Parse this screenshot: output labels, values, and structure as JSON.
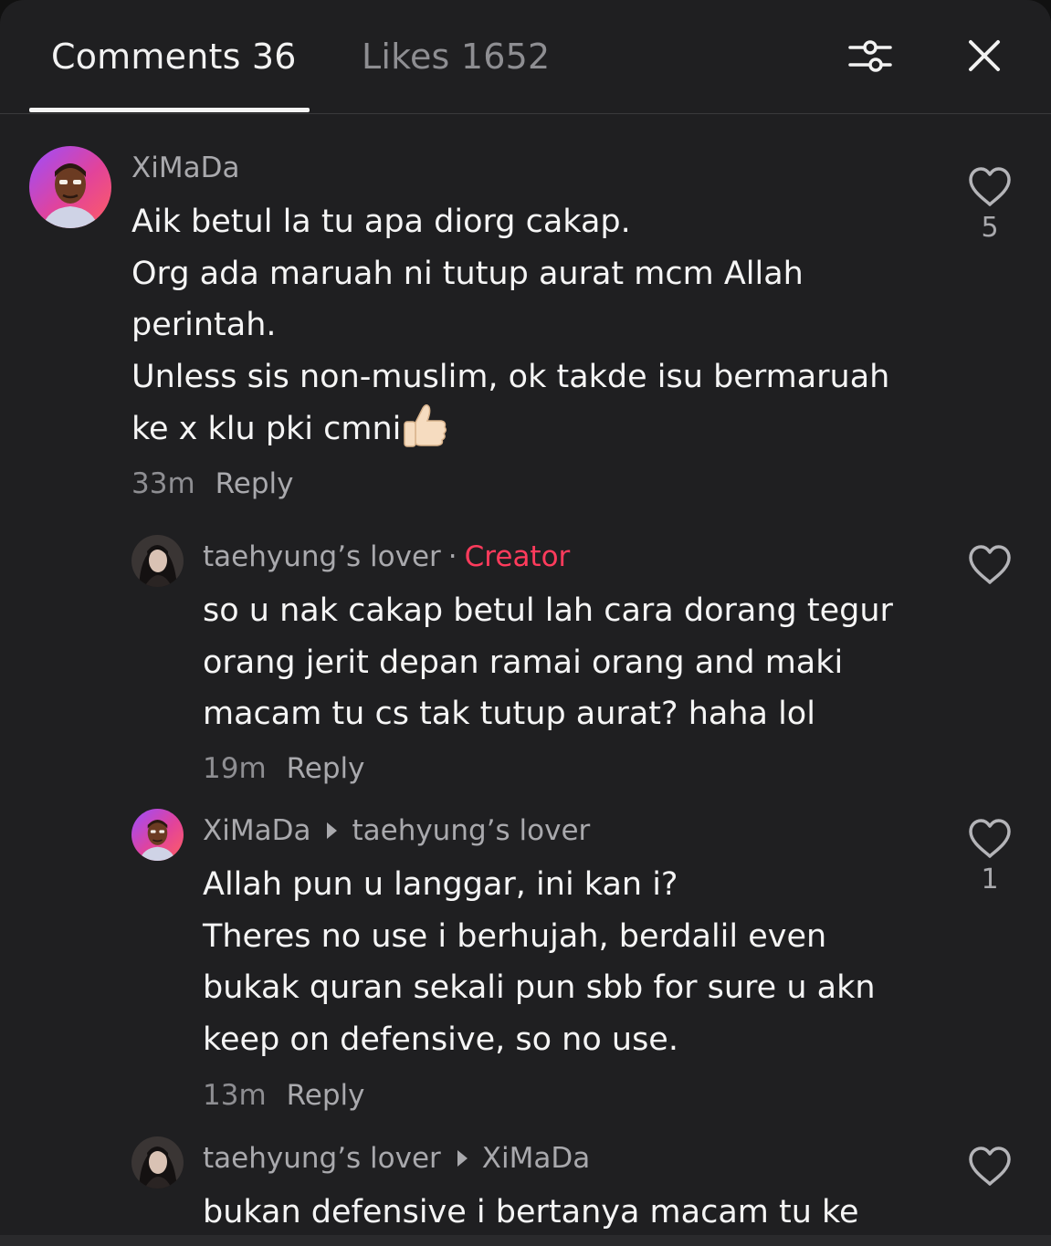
{
  "header": {
    "comments_tab": "Comments 36",
    "likes_tab": "Likes 1652",
    "active_tab": "comments"
  },
  "comments": [
    {
      "username": "XiMaDa",
      "lines": [
        "Aik betul la tu apa diorg cakap.",
        "Org ada maruah ni tutup aurat mcm Allah",
        "perintah.",
        "Unless sis non-muslim, ok takde isu bermaruah",
        "ke x klu pki cmni"
      ],
      "emoji": "thumbs-up",
      "time": "33m",
      "reply_label": "Reply",
      "likes": "5"
    },
    {
      "username": "taehyung’s lover",
      "separator": "·",
      "badge": "Creator",
      "lines": [
        "so u nak cakap betul lah cara dorang tegur",
        "orang jerit depan ramai orang and maki",
        "macam tu cs tak tutup aurat? haha lol"
      ],
      "time": "19m",
      "reply_label": "Reply",
      "likes": ""
    },
    {
      "username": "XiMaDa",
      "reply_to": "taehyung’s lover",
      "lines": [
        "Allah pun u langgar, ini kan i?",
        "Theres no use i berhujah, berdalil even",
        "bukak quran sekali pun sbb for sure u akn",
        "keep on defensive, so no use."
      ],
      "time": "13m",
      "reply_label": "Reply",
      "likes": "1"
    },
    {
      "username": "taehyung’s lover",
      "reply_to": "XiMaDa",
      "lines": [
        "bukan defensive i bertanya macam tu ke"
      ],
      "likes": ""
    }
  ],
  "colors": {
    "background": "#1f1f21",
    "creator_badge": "#ff3b5c",
    "muted_text": "#a9a9ad",
    "primary_text": "#f5f5f5"
  }
}
